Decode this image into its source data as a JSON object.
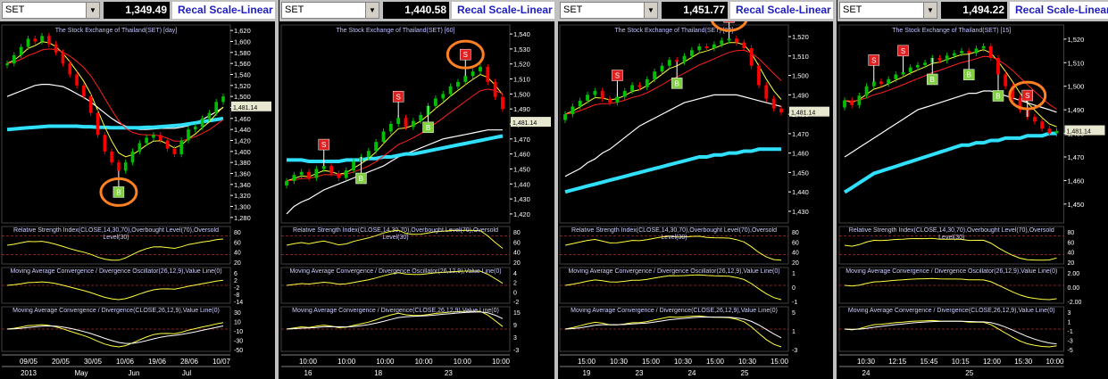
{
  "panels": [
    {
      "symbol": "SET",
      "price": "1,349.49",
      "scale_button": "Recal Scale-Linear",
      "title": "The Stock Exchange of Thailand(SET) [day]",
      "last_label": "1,481.14",
      "last_value": 1481.14,
      "price_ticks": [
        "1,620",
        "1,600",
        "1,580",
        "1,560",
        "1,540",
        "1,520",
        "1,500",
        "1,480",
        "1,460",
        "1,440",
        "1,420",
        "1,400",
        "1,380",
        "1,360",
        "1,340",
        "1,320",
        "1,300",
        "1,280"
      ],
      "price_range": [
        1270,
        1630
      ],
      "rsi_label": "Relative Strength Index(CLOSE,14,30,70),Overbought Level(70),Oversold Level(30)",
      "rsi_ticks": [
        "80",
        "60",
        "40",
        "20"
      ],
      "osc_label": "Moving Average Convergence / Divergence Oscillator(26,12,9),Value Line(0)",
      "osc_ticks": [
        "6",
        "2",
        "-2",
        "-8",
        "-14"
      ],
      "macd_label": "Moving Average Convergence / Divergence(CLOSE,26,12,9),Value Line(0)",
      "macd_ticks": [
        "30",
        "10",
        "-10",
        "-30",
        "-50"
      ],
      "x_ticks": [
        "09/05",
        "20/05",
        "30/05",
        "10/06",
        "19/06",
        "28/06",
        "10/07"
      ],
      "x_periods": [
        "2013",
        "May",
        "Jun",
        "Jul"
      ],
      "signals": [
        {
          "type": "B",
          "label": "B"
        }
      ]
    },
    {
      "symbol": "SET",
      "price": "1,440.58",
      "scale_button": "Recal Scale-Linear",
      "title": "The Stock Exchange of Thailand(SET) [60]",
      "last_label": "1,481.14",
      "last_value": 1481.14,
      "price_ticks": [
        "1,540",
        "1,530",
        "1,520",
        "1,510",
        "1,500",
        "1,490",
        "1,480",
        "1,470",
        "1,460",
        "1,450",
        "1,440",
        "1,430",
        "1,420"
      ],
      "price_range": [
        1414,
        1546
      ],
      "rsi_label": "Relative Strength Index(CLOSE,14,30,70),Overbought Level(70),Oversold Level(30)",
      "rsi_ticks": [
        "80",
        "60",
        "40",
        "20"
      ],
      "osc_label": "Moving Average Convergence / Divergence Oscillator(26,12,9),Value Line(0)",
      "osc_ticks": [
        "4",
        "2",
        "0",
        "-2"
      ],
      "macd_label": "Moving Average Convergence / Divergence(CLOSE,26,12,9),Value Line(0)",
      "macd_ticks": [
        "15",
        "9",
        "3",
        "-3"
      ],
      "x_ticks": [
        "10:00",
        "10:00",
        "10:00",
        "10:00",
        "10:00",
        "10:00"
      ],
      "x_periods": [
        "16",
        "18",
        "23"
      ],
      "signals": [
        {
          "type": "S",
          "label": "S"
        },
        {
          "type": "B",
          "label": "B"
        },
        {
          "type": "S",
          "label": "S"
        },
        {
          "type": "B",
          "label": "B"
        },
        {
          "type": "S",
          "label": "S"
        }
      ]
    },
    {
      "symbol": "SET",
      "price": "1,451.77",
      "scale_button": "Recal Scale-Linear",
      "title": "The Stock Exchange of Thailand(SET) [30]",
      "last_label": "1,481.14",
      "last_value": 1481.14,
      "price_ticks": [
        "1,520",
        "1,510",
        "1,500",
        "1,490",
        "1,480",
        "1,470",
        "1,460",
        "1,450",
        "1,440",
        "1,430"
      ],
      "price_range": [
        1424,
        1526
      ],
      "rsi_label": "Relative Strength Index(CLOSE,14,30,70),Overbought Level(70),Oversold Level(30)",
      "rsi_ticks": [
        "80",
        "60",
        "40",
        "20"
      ],
      "osc_label": "Moving Average Convergence / Divergence Oscillator(26,12,9),Value Line(0)",
      "osc_ticks": [
        "1",
        "0",
        "-1"
      ],
      "macd_label": "Moving Average Convergence / Divergence(CLOSE,26,12,9),Value Line(0)",
      "macd_ticks": [
        "5",
        "1",
        "-3"
      ],
      "x_ticks": [
        "15:00",
        "10:30",
        "15:00",
        "10:30",
        "15:00",
        "10:30",
        "15:00"
      ],
      "x_periods": [
        "19",
        "23",
        "24",
        "25"
      ],
      "signals": [
        {
          "type": "S",
          "label": "S"
        },
        {
          "type": "B",
          "label": "B"
        },
        {
          "type": "S",
          "label": "S"
        }
      ]
    },
    {
      "symbol": "SET",
      "price": "1,494.22",
      "scale_button": "Recal Scale-Linear",
      "title": "The Stock Exchange of Thailand(SET) [15]",
      "last_label": "1,481.14",
      "last_value": 1481.14,
      "price_ticks": [
        "1,520",
        "1,510",
        "1,500",
        "1,490",
        "1,480",
        "1,470",
        "1,460",
        "1,450"
      ],
      "price_range": [
        1442,
        1526
      ],
      "rsi_label": "Relative Strength Index(CLOSE,14,30,70),Overbought Level(70),Oversold Level(30)",
      "rsi_ticks": [
        "80",
        "60",
        "40",
        "20"
      ],
      "osc_label": "Moving Average Convergence / Divergence Oscillator(26,12,9),Value Line(0)",
      "osc_ticks": [
        "2.00",
        "0.00",
        "-2.00"
      ],
      "macd_label": "Moving Average Convergence / Divergence(CLOSE,26,12,9),Value Line(0)",
      "macd_ticks": [
        "3",
        "1",
        "-1",
        "-3",
        "-5"
      ],
      "x_ticks": [
        "10:30",
        "12:15",
        "15:45",
        "10:15",
        "12:00",
        "15:30",
        "10:00"
      ],
      "x_periods": [
        "24",
        "25"
      ],
      "signals": [
        {
          "type": "S",
          "label": "S"
        },
        {
          "type": "S",
          "label": "S"
        },
        {
          "type": "B",
          "label": "B"
        },
        {
          "type": "B",
          "label": "B"
        },
        {
          "type": "B",
          "label": "B"
        },
        {
          "type": "S",
          "label": "S"
        }
      ]
    }
  ],
  "colors": {
    "background": "#000000",
    "up_candle": "#00c000",
    "down_candle": "#ff0000",
    "ma_white": "#ffffff",
    "ma_yellow": "#ffff40",
    "ma_red": "#ff2020",
    "ma_cyan": "#30e0ff",
    "buy_signal": "#80d040",
    "sell_signal": "#e02020",
    "highlight_circle": "#ff8020",
    "axis_text": "#ffffff",
    "indicator_label": "#d0d0ff",
    "ref_line": "#ff4040"
  },
  "chart_data": [
    {
      "type": "candlestick",
      "title": "The Stock Exchange of Thailand(SET) [day]",
      "ylim": [
        1270,
        1630
      ],
      "close": [
        1560,
        1575,
        1590,
        1605,
        1600,
        1610,
        1595,
        1580,
        1560,
        1540,
        1520,
        1500,
        1470,
        1430,
        1400,
        1380,
        1365,
        1380,
        1400,
        1415,
        1425,
        1430,
        1420,
        1405,
        1395,
        1420,
        1440,
        1445,
        1460,
        1470,
        1490,
        1500
      ],
      "series_ma": [
        {
          "values": [
            1500,
            1505,
            1510,
            1515,
            1520,
            1522,
            1522,
            1520,
            1518,
            1512,
            1505,
            1498,
            1490,
            1480,
            1470,
            1460,
            1452,
            1446,
            1442,
            1440,
            1440,
            1441,
            1442,
            1442,
            1442,
            1444,
            1447,
            1452,
            1458,
            1465,
            1472,
            1480
          ]
        },
        {
          "values": [
            1440,
            1441,
            1442,
            1443,
            1444,
            1445,
            1446,
            1446,
            1446,
            1446,
            1446,
            1445,
            1445,
            1444,
            1444,
            1443,
            1443,
            1443,
            1443,
            1443,
            1444,
            1444,
            1445,
            1446,
            1447,
            1448,
            1450,
            1452,
            1454,
            1456,
            1458,
            1460
          ]
        }
      ]
    },
    {
      "type": "candlestick",
      "title": "The Stock Exchange of Thailand(SET) [60]",
      "ylim": [
        1414,
        1546
      ],
      "close": [
        1442,
        1446,
        1448,
        1444,
        1450,
        1452,
        1447,
        1444,
        1449,
        1455,
        1458,
        1462,
        1468,
        1475,
        1480,
        1484,
        1478,
        1482,
        1486,
        1492,
        1497,
        1500,
        1505,
        1508,
        1512,
        1515,
        1518,
        1508,
        1498,
        1490
      ],
      "series_ma": [
        {
          "values": [
            1420,
            1425,
            1428,
            1430,
            1433,
            1436,
            1438,
            1440,
            1442,
            1444,
            1446,
            1448,
            1450,
            1452,
            1455,
            1458,
            1460,
            1462,
            1464,
            1466,
            1468,
            1470,
            1471,
            1472,
            1473,
            1474,
            1475,
            1476,
            1476,
            1476
          ]
        },
        {
          "values": [
            1456,
            1456,
            1456,
            1455,
            1455,
            1455,
            1455,
            1455,
            1456,
            1456,
            1456,
            1457,
            1457,
            1458,
            1458,
            1459,
            1460,
            1460,
            1461,
            1462,
            1463,
            1464,
            1465,
            1466,
            1467,
            1468,
            1469,
            1470,
            1471,
            1472
          ]
        }
      ]
    },
    {
      "type": "candlestick",
      "title": "The Stock Exchange of Thailand(SET) [30]",
      "ylim": [
        1424,
        1526
      ],
      "close": [
        1480,
        1484,
        1487,
        1490,
        1492,
        1488,
        1486,
        1489,
        1492,
        1495,
        1494,
        1498,
        1502,
        1505,
        1508,
        1507,
        1510,
        1513,
        1515,
        1514,
        1516,
        1518,
        1519,
        1517,
        1514,
        1505,
        1495,
        1488,
        1483,
        1481
      ],
      "series_ma": [
        {
          "values": [
            1448,
            1450,
            1452,
            1455,
            1457,
            1460,
            1462,
            1465,
            1468,
            1471,
            1474,
            1476,
            1478,
            1480,
            1482,
            1484,
            1486,
            1487,
            1488,
            1489,
            1490,
            1490,
            1490,
            1490,
            1489,
            1488,
            1487,
            1486,
            1485,
            1484
          ]
        },
        {
          "values": [
            1440,
            1441,
            1442,
            1443,
            1444,
            1445,
            1446,
            1447,
            1448,
            1449,
            1450,
            1451,
            1452,
            1453,
            1454,
            1455,
            1456,
            1457,
            1458,
            1458,
            1459,
            1459,
            1460,
            1460,
            1461,
            1461,
            1462,
            1462,
            1462,
            1462
          ]
        }
      ]
    },
    {
      "type": "candlestick",
      "title": "The Stock Exchange of Thailand(SET) [15]",
      "ylim": [
        1442,
        1526
      ],
      "close": [
        1494,
        1492,
        1496,
        1500,
        1502,
        1501,
        1503,
        1505,
        1506,
        1508,
        1509,
        1510,
        1512,
        1511,
        1513,
        1514,
        1515,
        1514,
        1516,
        1517,
        1512,
        1505,
        1500,
        1495,
        1490,
        1487,
        1485,
        1482,
        1480,
        1481
      ],
      "series_ma": [
        {
          "values": [
            1470,
            1472,
            1474,
            1476,
            1478,
            1480,
            1482,
            1484,
            1486,
            1488,
            1490,
            1491,
            1492,
            1493,
            1494,
            1495,
            1496,
            1497,
            1497,
            1498,
            1498,
            1497,
            1496,
            1495,
            1494,
            1493,
            1492,
            1491,
            1490,
            1489
          ]
        },
        {
          "values": [
            1455,
            1457,
            1459,
            1461,
            1463,
            1464,
            1465,
            1466,
            1467,
            1468,
            1469,
            1470,
            1471,
            1472,
            1473,
            1474,
            1475,
            1475,
            1476,
            1476,
            1477,
            1477,
            1478,
            1478,
            1478,
            1479,
            1479,
            1479,
            1480,
            1480
          ]
        }
      ]
    }
  ]
}
